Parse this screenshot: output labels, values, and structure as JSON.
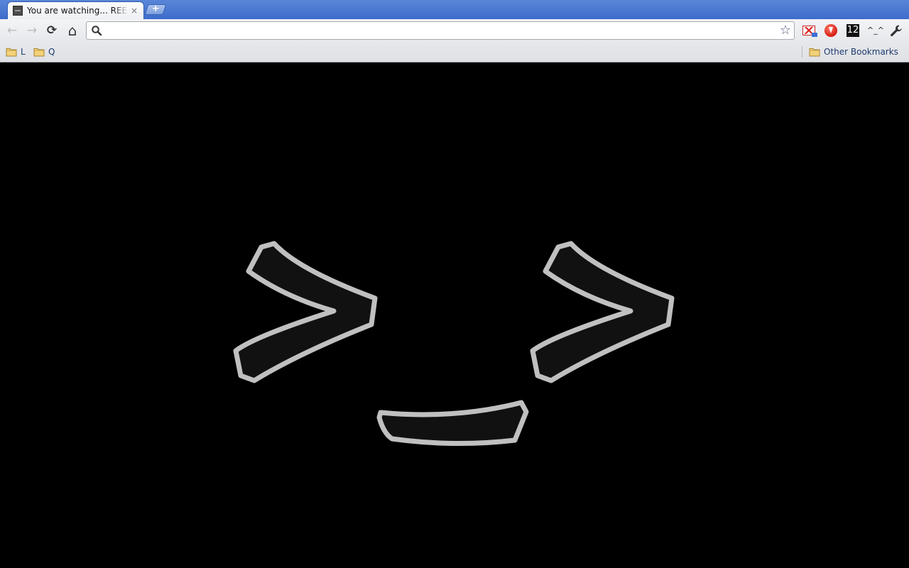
{
  "browser": {
    "tab": {
      "title": "You are watching... REE",
      "close_glyph": "×"
    },
    "new_tab_glyph": "+",
    "toolbar": {
      "back_glyph": "←",
      "forward_glyph": "→",
      "reload_glyph": "⟳",
      "home_glyph": "⌂",
      "address_value": "",
      "star_glyph": "☆"
    },
    "extensions": {
      "gmail_icon": "gmail-checker-icon",
      "red_icon": "red-circle-extension-icon",
      "counter_value": "12",
      "face_label": "^_^",
      "menu_icon": "wrench-icon"
    },
    "bookmarks": {
      "items": [
        {
          "label": "L"
        },
        {
          "label": "Q"
        }
      ],
      "other_label": "Other Bookmarks"
    }
  },
  "page": {
    "background": "#000000",
    "emoticon_outline_color": "#c0c0c0",
    "emoticon_fill_color": "#111111",
    "emoticon": ">_>"
  }
}
